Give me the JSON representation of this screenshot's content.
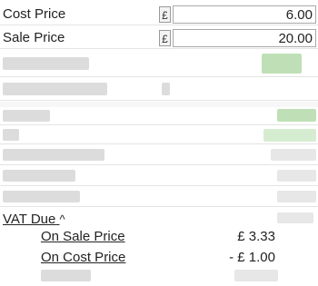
{
  "cost_price": {
    "label": "Cost Price",
    "currency": "£",
    "value": "6.00"
  },
  "sale_price": {
    "label": "Sale Price",
    "currency": "£",
    "value": "20.00"
  },
  "vat": {
    "label": "VAT Due",
    "toggle_icon": "chevron-up-icon",
    "toggle_glyph": "^",
    "on_sale_price": {
      "label": "On Sale Price",
      "value": "£ 3.33"
    },
    "on_cost_price": {
      "label": "On Cost Price",
      "value": "- £ 1.00"
    }
  },
  "colors": {
    "blur_grey": "#dcdcdc",
    "blur_green": "#bfe0b6"
  }
}
